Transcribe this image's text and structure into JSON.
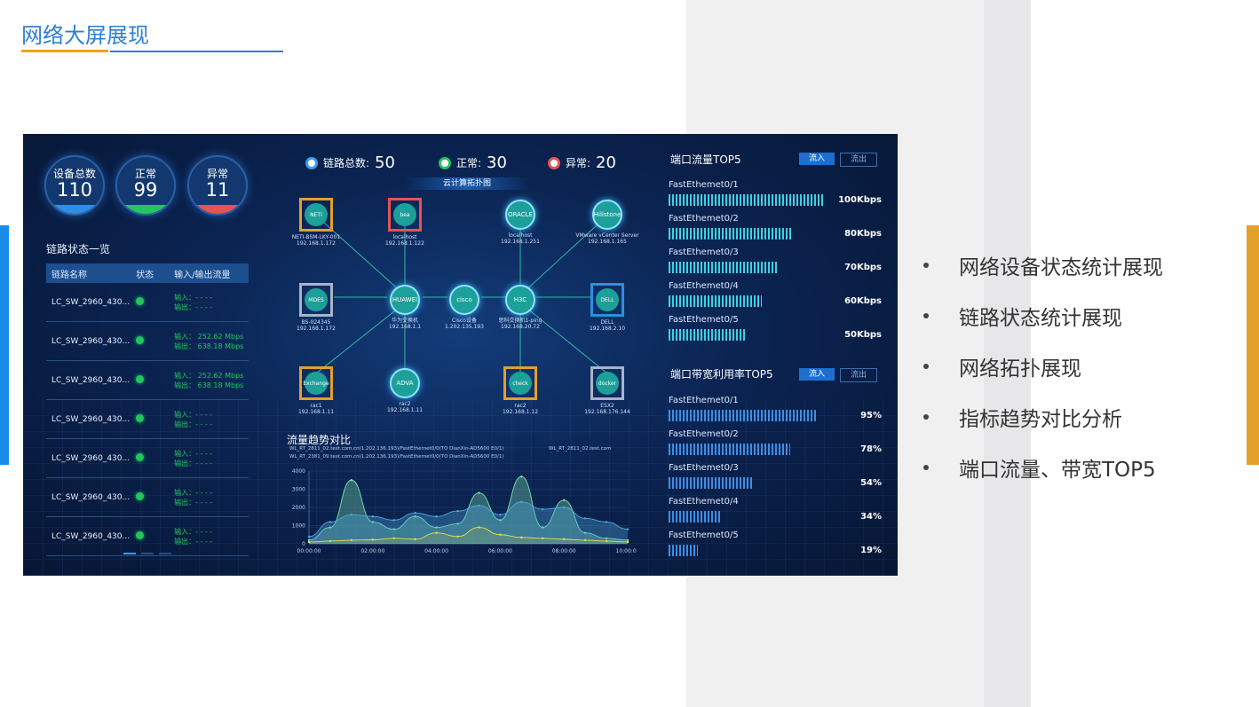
{
  "slide": {
    "title": "网络大屏展现",
    "bullets": [
      "网络设备状态统计展现",
      "链路状态统计展现",
      "网络拓扑展现",
      "指标趋势对比分析",
      "端口流量、带宽TOP5"
    ],
    "colors": {
      "accent_blue": "#2b7fd6",
      "accent_orange": "#f0a11c",
      "right_bar": "#e3a12a",
      "left_bar": "#1a8ce6"
    }
  },
  "dashboard": {
    "device_stats": [
      {
        "label": "设备总数",
        "value": "110",
        "color": "#2f8de4"
      },
      {
        "label": "正常",
        "value": "99",
        "color": "#22c55e"
      },
      {
        "label": "异常",
        "value": "11",
        "color": "#e55353"
      }
    ],
    "link_summary": [
      {
        "label": "链路总数:",
        "value": "50",
        "color": "#3b9cf0"
      },
      {
        "label": "正常:",
        "value": "30",
        "color": "#22c55e"
      },
      {
        "label": "异常:",
        "value": "20",
        "color": "#e55353"
      }
    ],
    "link_list": {
      "title": "链路状态一览",
      "headers": [
        "链路名称",
        "状态",
        "输入/输出流量"
      ],
      "rows": [
        {
          "name": "LC_SW_2960_430...",
          "in": "输入：- -  - -",
          "out": "输出：- -  - -"
        },
        {
          "name": "LC_SW_2960_430...",
          "in": "输入：  252.62 Mbps",
          "out": "输出：  638.18 Mbps"
        },
        {
          "name": "LC_SW_2960_430...",
          "in": "输入：  252.62 Mbps",
          "out": "输出：  638.18 Mbps"
        },
        {
          "name": "LC_SW_2960_430...",
          "in": "输入：- -  - -",
          "out": "输出：- -  - -"
        },
        {
          "name": "LC_SW_2960_430...",
          "in": "输入：- -  - -",
          "out": "输出：- -  - -"
        },
        {
          "name": "LC_SW_2960_430...",
          "in": "输入：- -  - -",
          "out": "输出：- -  - -"
        },
        {
          "name": "LC_SW_2960_430...",
          "in": "输入：- -  - -",
          "out": "输出：- -  - -"
        }
      ]
    },
    "topology": {
      "title": "云计算拓扑图",
      "nodes": [
        {
          "icon": "NETI",
          "name": "NETI-BSM-LKY-001",
          "ip": "192.168.1.172"
        },
        {
          "icon": "bea",
          "name": "localhost",
          "ip": "192.168.1.122"
        },
        {
          "icon": "ORACLE",
          "name": "localhost",
          "ip": "192.168.1.251"
        },
        {
          "icon": "Hillstone",
          "name": "VMware vCenter Server",
          "ip": "192.168.1.165"
        },
        {
          "icon": "MDES",
          "name": "BS-024345",
          "ip": "192.168.1.172"
        },
        {
          "icon": "HUAWEI",
          "name": "华为交换机",
          "ip": "192.168.1.1"
        },
        {
          "icon": "cisco",
          "name": "Cisco设备",
          "ip": "1.202.135.193"
        },
        {
          "icon": "H3C",
          "name": "思科交换机1-ping",
          "ip": "192.168.20.72"
        },
        {
          "icon": "DELL",
          "name": "DELL",
          "ip": "192.168.2.10"
        },
        {
          "icon": "Exchange",
          "name": "rac1",
          "ip": "192.168.1.11"
        },
        {
          "icon": "ADVA",
          "name": "rac2",
          "ip": "192.168.1.11"
        },
        {
          "icon": "check",
          "name": "rac2",
          "ip": "192.168.1.12"
        },
        {
          "icon": "docker",
          "name": "ESX2",
          "ip": "192.168.176.144"
        }
      ]
    },
    "trend": {
      "title": "流量趋势对比",
      "legend": [
        "WL_RT_2811_02.test.com.cn(1.202.136.193)/FastEthernet0/0(TO DianXin-AD5600 E0/1)",
        "WL_RT_2811_02.test.com",
        "WL_RT_2381_09.test.com.cn(1.202.136.193)/FastEthernet0/0(TO DianXin-AD5600 E0/1)"
      ],
      "chart_data": {
        "type": "area",
        "x": [
          "00:00:00",
          "02:00:00",
          "04:00:00",
          "06:00:00",
          "08:00:00",
          "10:00:00"
        ],
        "yticks": [
          "0",
          "1000",
          "2000",
          "3000",
          "4000"
        ],
        "ylim": [
          0,
          4000
        ],
        "series": [
          {
            "name": "WL_RT_2811_02.test.com.cn(1.202.136.193)/FastEthernet0/0(TO DianXin-AD5600 E0/1)",
            "color": "#7de3b0",
            "values": [
              200,
              900,
              3500,
              1200,
              800,
              1500,
              900,
              1100,
              2800,
              1300,
              3700,
              900,
              2400,
              600,
              300,
              200
            ]
          },
          {
            "name": "WL_RT_2381_09.test.com.cn(1.202.136.193)/FastEthernet0/0(TO DianXin-AD5600 E0/1)",
            "color": "#4fa8e0",
            "values": [
              400,
              1200,
              1600,
              1500,
              1300,
              1700,
              1500,
              1800,
              2100,
              1600,
              2300,
              1900,
              2000,
              1400,
              1200,
              800
            ]
          },
          {
            "name": "WL_RT_2811_02.test.com",
            "color": "#e8e04a",
            "values": [
              100,
              150,
              200,
              220,
              300,
              250,
              600,
              400,
              900,
              500,
              350,
              300,
              250,
              200,
              150,
              100
            ]
          }
        ]
      }
    },
    "port_traffic": {
      "title": "端口流量TOP5",
      "tabs": [
        "流入",
        "流出"
      ],
      "items": [
        {
          "name": "FastEthemet0/1",
          "value": "100Kbps",
          "pct": 1.0
        },
        {
          "name": "FastEthemet0/2",
          "value": "80Kbps",
          "pct": 0.8
        },
        {
          "name": "FastEthemet0/3",
          "value": "70Kbps",
          "pct": 0.7
        },
        {
          "name": "FastEthemet0/4",
          "value": "60Kbps",
          "pct": 0.6
        },
        {
          "name": "FastEthemet0/5",
          "value": "50Kbps",
          "pct": 0.5
        }
      ]
    },
    "port_bandwidth": {
      "title": "端口带宽利用率TOP5",
      "tabs": [
        "流入",
        "流出"
      ],
      "items": [
        {
          "name": "FastEthemet0/1",
          "value": "95%",
          "pct": 0.95
        },
        {
          "name": "FastEthemet0/2",
          "value": "78%",
          "pct": 0.78
        },
        {
          "name": "FastEthemet0/3",
          "value": "54%",
          "pct": 0.54
        },
        {
          "name": "FastEthemet0/4",
          "value": "34%",
          "pct": 0.34
        },
        {
          "name": "FastEthemet0/5",
          "value": "19%",
          "pct": 0.19
        }
      ]
    }
  }
}
